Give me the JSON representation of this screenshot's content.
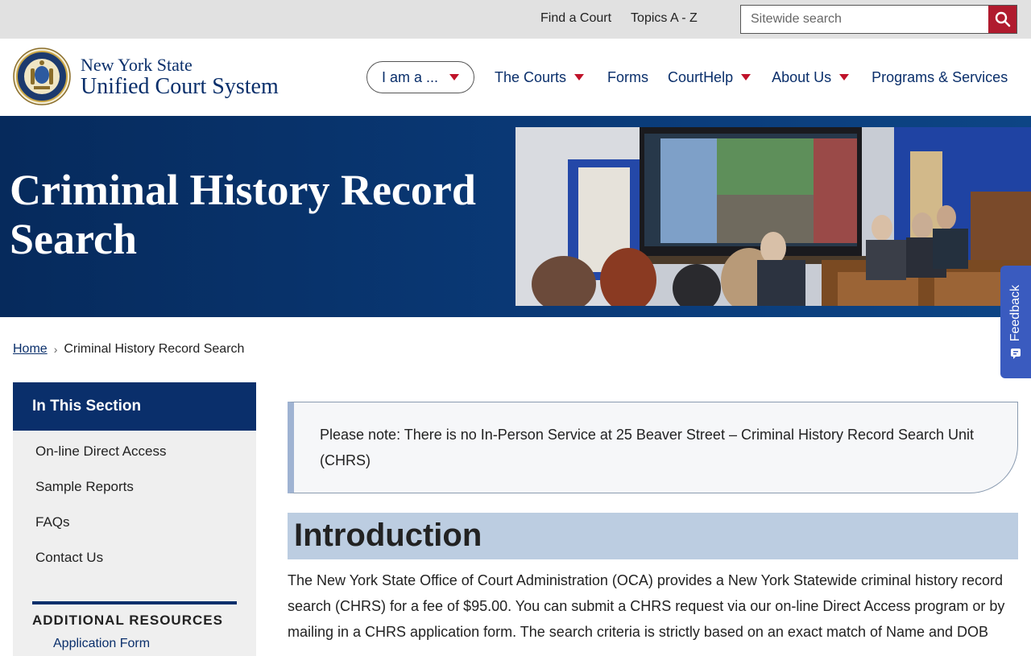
{
  "utility": {
    "links": [
      "Find a Court",
      "Topics A - Z"
    ],
    "search_placeholder": "Sitewide search"
  },
  "brand": {
    "line1": "New York State",
    "line2": "Unified Court System",
    "seal_text": "NEW YORK STATE UNIFIED COURT SYSTEM"
  },
  "nav": {
    "iam_label": "I am a ...",
    "items": [
      {
        "label": "The Courts",
        "has_dropdown": true
      },
      {
        "label": "Forms",
        "has_dropdown": false
      },
      {
        "label": "CourtHelp",
        "has_dropdown": true
      },
      {
        "label": "About Us",
        "has_dropdown": true
      },
      {
        "label": "Programs & Services",
        "has_dropdown": false
      }
    ]
  },
  "hero": {
    "title": "Criminal History Record Search"
  },
  "feedback_label": "Feedback",
  "breadcrumb": {
    "home": "Home",
    "current": "Criminal History Record Search"
  },
  "sidebar": {
    "heading": "In This Section",
    "items": [
      "On-line Direct Access",
      "Sample Reports",
      "FAQs",
      "Contact Us"
    ],
    "additional_heading": "ADDITIONAL RESOURCES",
    "additional_first": "Application Form"
  },
  "main": {
    "notice": "Please note: There is no In-Person Service at 25 Beaver Street – Criminal History Record Search Unit (CHRS)",
    "intro_heading": "Introduction",
    "intro_text": "The New York State Office of Court Administration (OCA) provides a New York Statewide criminal history record search (CHRS) for a fee of $95.00. You can submit a CHRS request via our on-line Direct Access program or by mailing in a CHRS application form. The search criteria is strictly based on an exact match of Name and DOB"
  },
  "colors": {
    "navy": "#0a2f6b",
    "accent_red": "#c0132a",
    "search_red": "#b01b2e",
    "intro_bg": "#bccde1",
    "feedback_blue": "#3a5bbf"
  }
}
